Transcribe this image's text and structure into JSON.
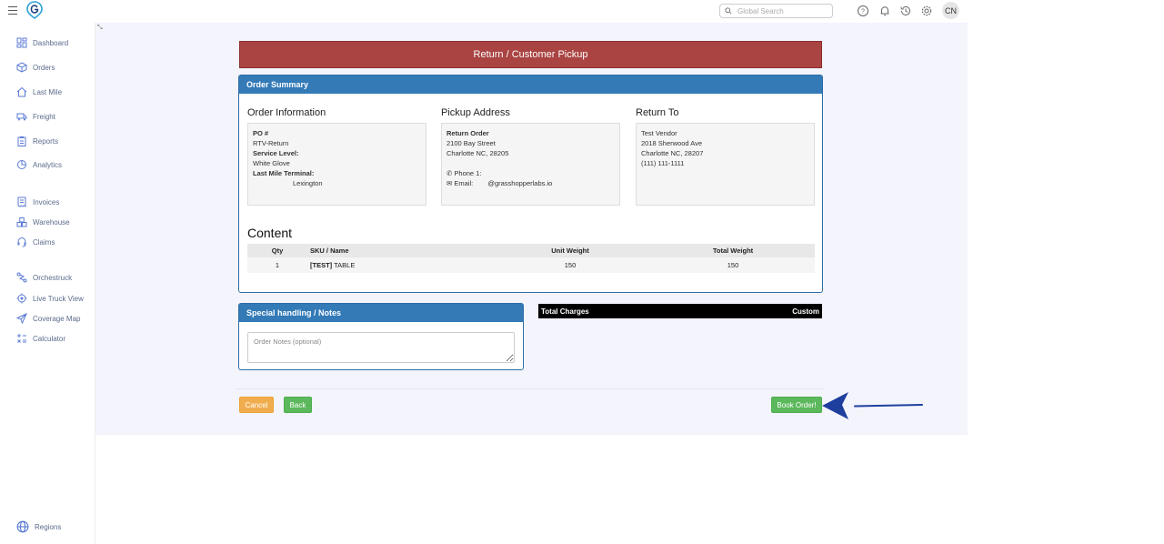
{
  "header": {
    "search_placeholder": "Global Search",
    "avatar_initials": "CN",
    "icons": [
      "menu-icon",
      "logo-icon",
      "search-icon",
      "help-icon",
      "bell-icon",
      "history-icon",
      "gear-icon"
    ]
  },
  "sidebar": {
    "items": [
      {
        "label": "Dashboard",
        "icon": "dashboard-icon"
      },
      {
        "label": "Orders",
        "icon": "box-icon"
      },
      {
        "label": "Last Mile",
        "icon": "house-icon"
      },
      {
        "label": "Freight",
        "icon": "truck-icon"
      },
      {
        "label": "Reports",
        "icon": "clipboard-icon"
      },
      {
        "label": "Analytics",
        "icon": "analytics-icon"
      },
      {
        "label": "Invoices",
        "icon": "invoice-icon"
      },
      {
        "label": "Warehouse",
        "icon": "warehouse-icon"
      },
      {
        "label": "Claims",
        "icon": "headset-icon"
      },
      {
        "label": "Orchestruck",
        "icon": "route-icon"
      },
      {
        "label": "Live Truck View",
        "icon": "target-icon"
      },
      {
        "label": "Coverage Map",
        "icon": "send-icon"
      },
      {
        "label": "Calculator",
        "icon": "calculator-icon"
      },
      {
        "label": "Regions",
        "icon": "globe-icon"
      }
    ]
  },
  "page": {
    "banner_title": "Return / Customer Pickup",
    "summary": {
      "heading": "Order Summary",
      "order_info": {
        "title": "Order Information",
        "po_label": "PO #",
        "po_value": "RTV-Return",
        "service_label": "Service Level:",
        "service_value": "White Glove",
        "terminal_label": "Last Mile Terminal:",
        "terminal_value": "Lexington"
      },
      "pickup": {
        "title": "Pickup Address",
        "name": "Return Order",
        "line1": "2100 Bay Street",
        "line2": "Charlotte NC, 28205",
        "phone_label": "Phone 1:",
        "email_label": "Email:",
        "email_value": "@grasshopperlabs.io"
      },
      "return_to": {
        "title": "Return To",
        "name": "Test Vendor",
        "line1": "2018 Sherwood Ave",
        "line2": "Charlotte NC, 28207",
        "phone": "(111) 111-1111"
      }
    },
    "content": {
      "title": "Content",
      "columns": [
        "Qty",
        "SKU / Name",
        "Unit Weight",
        "Total Weight"
      ],
      "rows": [
        {
          "qty": "1",
          "sku": "[TEST]",
          "name": "TABLE",
          "unit_weight": "150",
          "total_weight": "150"
        }
      ]
    },
    "notes": {
      "heading": "Special handling / Notes",
      "placeholder": "Order Notes (optional)"
    },
    "charges": {
      "label": "Total Charges",
      "value": "Custom"
    },
    "actions": {
      "cancel": "Cancel",
      "back": "Back",
      "book": "Book Order!"
    }
  },
  "colors": {
    "banner": "#a94442",
    "panel_header": "#337ab7",
    "cancel": "#f0ad4e",
    "success": "#5cb85c",
    "arrow": "#1f3f9e",
    "main_bg": "#f3f4fc"
  }
}
